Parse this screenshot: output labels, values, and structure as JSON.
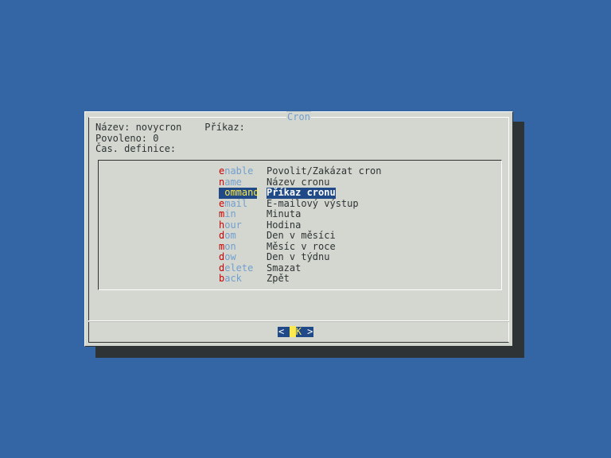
{
  "dialog": {
    "title": "Cron",
    "name_line": "Název: novycron    Příkaz:",
    "enabled_line": "Povoleno: 0",
    "time_line": "Čas. definice:"
  },
  "menu": {
    "items": [
      {
        "hot": "e",
        "rest": "nable",
        "desc": "Povolit/Zakázat cron"
      },
      {
        "hot": "n",
        "rest": "ame",
        "desc": "Název cronu"
      },
      {
        "hot": "c",
        "rest": "ommand",
        "desc": "Příkaz cronu"
      },
      {
        "hot": "e",
        "rest": "mail",
        "desc": "E-mailový výstup"
      },
      {
        "hot": "m",
        "rest": "in",
        "desc": "Minuta"
      },
      {
        "hot": "h",
        "rest": "our",
        "desc": "Hodina"
      },
      {
        "hot": "d",
        "rest": "om",
        "desc": "Den v měsíci"
      },
      {
        "hot": "m",
        "rest": "on",
        "desc": "Měsíc v roce"
      },
      {
        "hot": "d",
        "rest": "ow",
        "desc": "Den v týdnu"
      },
      {
        "hot": "d",
        "rest": "elete",
        "desc": "Smazat"
      },
      {
        "hot": "b",
        "rest": "ack",
        "desc": "Zpět"
      }
    ],
    "selected_index": 2
  },
  "buttons": {
    "ok_left": "< ",
    "ok_hot": "O",
    "ok_rest": "K",
    "ok_right": " >"
  },
  "colors": {
    "background": "#3465a4",
    "dialog": "#d3d7cf",
    "shadow": "#2e3436",
    "highlight": "#204a87",
    "hotkey": "#cc0000",
    "tag": "#729fcf",
    "selected_text": "#fce94f"
  }
}
